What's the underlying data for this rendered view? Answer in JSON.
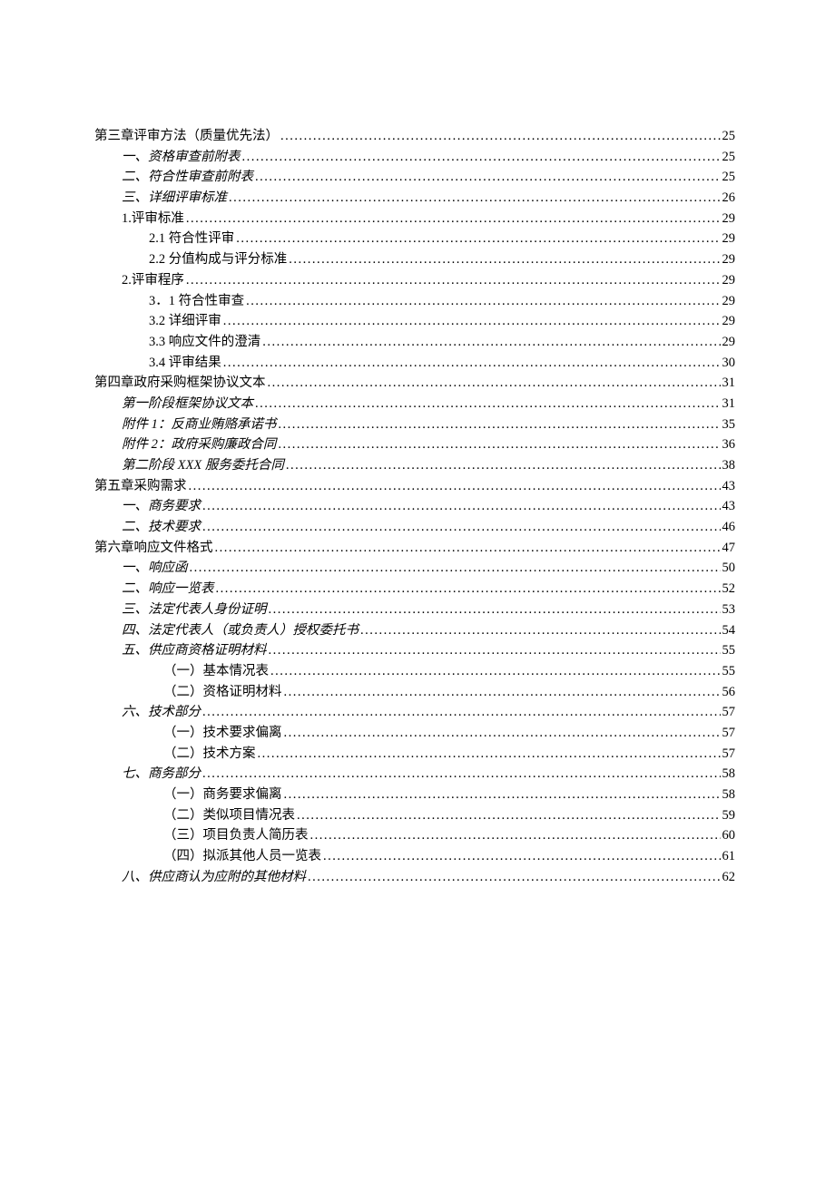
{
  "toc": [
    {
      "text": "第三章评审方法（质量优先法）",
      "page": "25",
      "indent": "lvl1",
      "italic": false,
      "leaderSpace": true
    },
    {
      "text": "一、资格审查前附表",
      "page": "25",
      "indent": "lvl2",
      "italic": true
    },
    {
      "text": "二、符合性审查前附表",
      "page": "25",
      "indent": "lvl2",
      "italic": true
    },
    {
      "text": "三、详细评审标准",
      "page": "26",
      "indent": "lvl2",
      "italic": true
    },
    {
      "text": "1.评审标准 ",
      "page": "29",
      "indent": "lvl2",
      "italic": false,
      "leaderSpace": true
    },
    {
      "text": "2.1 符合性评审",
      "page": "29",
      "indent": "lvl3",
      "italic": false
    },
    {
      "text": "2.2 分值构成与评分标准",
      "page": "29",
      "indent": "lvl3",
      "italic": false
    },
    {
      "text": "2.评审程序 ",
      "page": "29",
      "indent": "lvl2",
      "italic": false,
      "leaderSpace": true
    },
    {
      "text": "3．1 符合性审查 ",
      "page": "29",
      "indent": "lvl3",
      "italic": false,
      "leaderSpace": true
    },
    {
      "text": "3.2  详细评审 ",
      "page": "29",
      "indent": "lvl3",
      "italic": false,
      "leaderSpace": true
    },
    {
      "text": "3.3  响应文件的澄清 ",
      "page": "29",
      "indent": "lvl3",
      "italic": false,
      "leaderSpace": true
    },
    {
      "text": "3.4  评审结果 ",
      "page": "30",
      "indent": "lvl3",
      "italic": false,
      "leaderSpace": true
    },
    {
      "text": "第四章政府采购框架协议文本",
      "page": "31",
      "indent": "lvl1",
      "italic": false
    },
    {
      "text": "第一阶段框架协议文本",
      "page": "31",
      "indent": "lvl2",
      "italic": true
    },
    {
      "text": "附件 1：反商业贿赂承诺书",
      "page": "35",
      "indent": "lvl2",
      "italic": true
    },
    {
      "text": "附件 2：政府采购廉政合同",
      "page": "36",
      "indent": "lvl2",
      "italic": true
    },
    {
      "text": "第二阶段 XXX 服务委托合同 ",
      "page": "38",
      "indent": "lvl2",
      "italic": true,
      "leaderSpace": true
    },
    {
      "text": "第五章采购需求",
      "page": "43",
      "indent": "lvl1",
      "italic": false
    },
    {
      "text": "一、商务要求",
      "page": "43",
      "indent": "lvl2",
      "italic": true
    },
    {
      "text": "二、技术要求",
      "page": "46",
      "indent": "lvl2",
      "italic": true
    },
    {
      "text": "第六章响应文件格式",
      "page": "47",
      "indent": "lvl1",
      "italic": false
    },
    {
      "text": "一、响应函",
      "page": "50",
      "indent": "lvl2",
      "italic": true
    },
    {
      "text": "二、响应一览表",
      "page": "52",
      "indent": "lvl2",
      "italic": true
    },
    {
      "text": "三、法定代表人身份证明",
      "page": "53",
      "indent": "lvl2",
      "italic": true
    },
    {
      "text": "四、法定代表人（或负责人）授权委托书",
      "page": "54",
      "indent": "lvl2",
      "italic": true
    },
    {
      "text": "五、供应商资格证明材料",
      "page": "55",
      "indent": "lvl2",
      "italic": true
    },
    {
      "text": "（一）基本情况表 ",
      "page": "55",
      "indent": "lvl4",
      "italic": false,
      "leaderSpace": true
    },
    {
      "text": "（二）资格证明材料 ",
      "page": "56",
      "indent": "lvl4",
      "italic": false,
      "leaderSpace": true
    },
    {
      "text": "六、技术部分",
      "page": "57",
      "indent": "lvl2",
      "italic": true
    },
    {
      "text": "（一）技术要求偏离 ",
      "page": "57",
      "indent": "lvl4",
      "italic": false,
      "leaderSpace": true
    },
    {
      "text": "（二）技术方案 ",
      "page": "57",
      "indent": "lvl4",
      "italic": false,
      "leaderSpace": true
    },
    {
      "text": "七、商务部分",
      "page": "58",
      "indent": "lvl2",
      "italic": true
    },
    {
      "text": "（一）商务要求偏离 ",
      "page": "58",
      "indent": "lvl4",
      "italic": false,
      "leaderSpace": true
    },
    {
      "text": "（二）类似项目情况表 ",
      "page": "59",
      "indent": "lvl4",
      "italic": false,
      "leaderSpace": true
    },
    {
      "text": "（三）项目负责人简历表 ",
      "page": "60",
      "indent": "lvl4",
      "italic": false,
      "leaderSpace": true
    },
    {
      "text": "（四）拟派其他人员一览表 ",
      "page": "61",
      "indent": "lvl4",
      "italic": false,
      "leaderSpace": true
    },
    {
      "text": "八、供应商认为应附的其他材料",
      "page": "62",
      "indent": "lvl2",
      "italic": true
    }
  ]
}
